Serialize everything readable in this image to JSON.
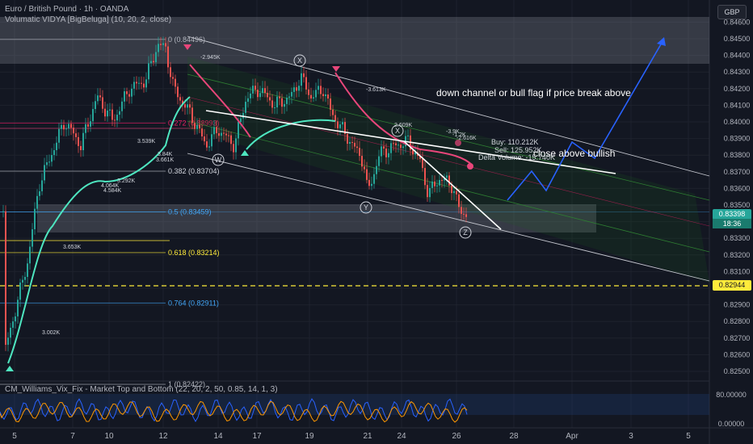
{
  "header": {
    "title": "Euro / British Pound · 1h · OANDA",
    "indicator": "Volumatic VIDYA [BigBeluga] (10, 20, 2, close)"
  },
  "currency": "GBP",
  "price_axis": {
    "ticks": [
      "0.84600",
      "0.84500",
      "0.84400",
      "0.84300",
      "0.84200",
      "0.84100",
      "0.84000",
      "0.83900",
      "0.83800",
      "0.83700",
      "0.83600",
      "0.83500",
      "0.83400",
      "0.83300",
      "0.83200",
      "0.83100",
      "0.83000",
      "0.82900",
      "0.82800",
      "0.82700",
      "0.82600",
      "0.82500",
      "0.82400"
    ],
    "current_price": "0.83398",
    "countdown": "18:36",
    "level_price": "0.82944"
  },
  "time_axis": {
    "ticks": [
      "5",
      "7",
      "10",
      "12",
      "14",
      "17",
      "19",
      "21",
      "24",
      "26",
      "28",
      "Apr",
      "3",
      "5"
    ]
  },
  "fibs": [
    {
      "label": "0 (0.84496)",
      "price": 0.84496,
      "color": "#b2b5be"
    },
    {
      "label": "0.272 (0.83993)",
      "price": 0.83993,
      "color": "#e91e63"
    },
    {
      "label": "0.382 (0.83704)",
      "price": 0.83704,
      "color": "#d1d4dc"
    },
    {
      "label": "0.5 (0.83459)",
      "price": 0.83459,
      "color": "#42a5f5"
    },
    {
      "label": "0.618 (0.83214)",
      "price": 0.83214,
      "color": "#ffeb3b"
    },
    {
      "label": "0.764 (0.82911)",
      "price": 0.82911,
      "color": "#42a5f5"
    },
    {
      "label": "1 (0.82422)",
      "price": 0.82422,
      "color": "#b2b5be"
    }
  ],
  "annotations": {
    "headline": "down channel or bull flag if price break above",
    "close_above": "close above bullish",
    "buy": "Buy: 110.212K",
    "sell": "Sell: 125.952K",
    "delta": "Delta Volume: -15.740K"
  },
  "waves": [
    "W",
    "X",
    "Y",
    "X",
    "Z"
  ],
  "volume_labels": [
    "-2.945K",
    "-3.613K",
    "3.539K",
    "3.84K",
    "3.661K",
    "3.292K",
    "4.064K",
    "4.584K",
    "3.653K",
    "3.002K",
    "2.609K",
    "-2.616K",
    "-3.9K",
    "-1.2K"
  ],
  "oscillator": {
    "title": "CM_Williams_Vix_Fix - Market Top and Bottom (22, 20, 2, 50, 0.85, 14, 1, 3)",
    "ticks": [
      "80.00000",
      "0.00000"
    ]
  },
  "colors": {
    "bull": "#26a69a",
    "bear": "#ef5350",
    "vidya_bull": "#4ee6c0",
    "vidya_bear": "#e8467a",
    "blue_path": "#2962ff",
    "level": "#ffeb3b"
  }
}
